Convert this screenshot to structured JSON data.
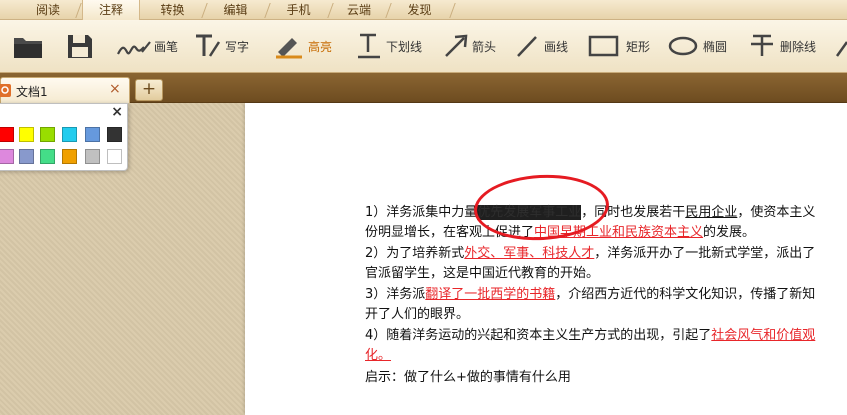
{
  "menu": {
    "tabs": [
      {
        "label": "阅读"
      },
      {
        "label": "注释"
      },
      {
        "label": "转换"
      },
      {
        "label": "编辑"
      },
      {
        "label": "手机"
      },
      {
        "label": "云端"
      },
      {
        "label": "发现"
      }
    ],
    "active_index": 1
  },
  "toolbar": {
    "open_icon": "folder-open-icon",
    "save_icon": "save-icon",
    "pen_label": "画笔",
    "write_label": "写字",
    "highlight_label": "高亮",
    "underline_label": "下划线",
    "arrow_label": "箭头",
    "line_label": "画线",
    "rect_label": "矩形",
    "ellipse_label": "椭圆",
    "strike_label": "删除线"
  },
  "tabs": {
    "doc_title": "文档1",
    "close_glyph": "×",
    "new_tab_glyph": "+"
  },
  "palette": {
    "close_glyph": "×",
    "colors": [
      "#ff0000",
      "#ffff00",
      "#99dd00",
      "#22ccee",
      "#6699dd",
      "#333333",
      "#dd88dd",
      "#8899cc",
      "#44dd88",
      "#f0a000",
      "#c0c0c0",
      "#ffffff"
    ]
  },
  "document": {
    "line1": {
      "a": "1）洋务派集中力量",
      "b": "优先发展军事工业",
      "c": "，同时也发展若干",
      "d": "民用企业",
      "e": "，使资本主义"
    },
    "line2": {
      "a": "份明显增长，在客观上促进了",
      "b": "中国早期工业和民族资本主义",
      "c": "的发展。"
    },
    "line3": {
      "a": "2）为了培养新式",
      "b": "外交、军事、科技人才",
      "c": "，洋务派开办了一批新式学堂，派出了"
    },
    "line4": {
      "a": "官派留学生，这是中国近代教育的开始。"
    },
    "line5": {
      "a": "3）洋务派",
      "b": "翻译了一批西学的书籍",
      "c": "，介绍西方近代的科学文化知识，传播了新知"
    },
    "line6": {
      "a": "开了人们的眼界。"
    },
    "line7": {
      "a": "4）随着洋务运动的兴起和资本主义生产方式的出现，引起了",
      "b": "社会风气和价值观"
    },
    "line8": {
      "a": "化。"
    },
    "line9": {
      "a": "启示：做了什么+做的事情有什么用"
    }
  },
  "colors": {
    "accent_orange": "#c66a00",
    "annotation_red": "#e51b22"
  }
}
